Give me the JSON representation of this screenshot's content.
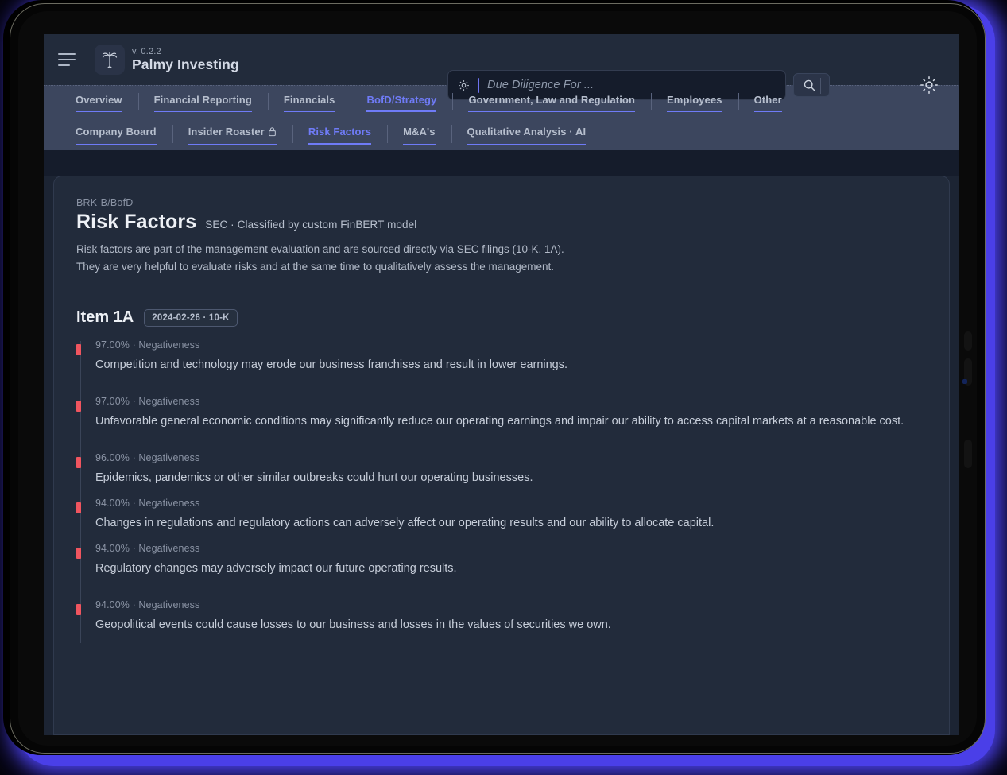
{
  "header": {
    "menu_icon": "hamburger-icon",
    "logo_icon": "palm-tree-icon",
    "version": "v. 0.2.2",
    "app_title": "Palmy Investing",
    "theme_icon": "sun-icon",
    "search": {
      "settings_icon": "gear-icon",
      "placeholder": "Due Diligence For ...",
      "value": "",
      "submit_icon": "search-icon"
    }
  },
  "nav_primary": {
    "items": [
      {
        "label": "Overview",
        "active": false
      },
      {
        "label": "Financial Reporting",
        "active": false
      },
      {
        "label": "Financials",
        "active": false
      },
      {
        "label": "BofD/Strategy",
        "active": true
      },
      {
        "label": "Government, Law and Regulation",
        "active": false
      },
      {
        "label": "Employees",
        "active": false
      },
      {
        "label": "Other",
        "active": false
      }
    ]
  },
  "nav_secondary": {
    "items": [
      {
        "label": "Company Board",
        "active": false,
        "icon": ""
      },
      {
        "label": "Insider Roaster",
        "active": false,
        "icon": "lock-icon"
      },
      {
        "label": "Risk Factors",
        "active": true,
        "icon": ""
      },
      {
        "label": "M&A's",
        "active": false,
        "icon": ""
      },
      {
        "label": "Qualitative Analysis  ·  AI",
        "active": false,
        "icon": ""
      }
    ]
  },
  "content": {
    "breadcrumb": "BRK-B/BofD",
    "title": "Risk Factors",
    "subtitle": "SEC · Classified by custom FinBERT model",
    "intro_line_1": "Risk factors are part of the management evaluation and are sourced directly via SEC filings (10-K, 1A).",
    "intro_line_2": "They are very helpful to evaluate risks and at the same time to qualitatively assess the management.",
    "section_title": "Item 1A",
    "section_badge": "2024-02-26 · 10-K",
    "marker_color": "#f0555f",
    "risk_items": [
      {
        "score": "97.00%",
        "label": "Negativeness",
        "meta": "97.00% · Negativeness",
        "text": "Competition and technology may erode our business franchises and result in lower earnings."
      },
      {
        "score": "97.00%",
        "label": "Negativeness",
        "meta": "97.00% · Negativeness",
        "text": "Unfavorable general economic conditions may significantly reduce our operating earnings and impair our ability to access capital markets at a reasonable cost."
      },
      {
        "score": "96.00%",
        "label": "Negativeness",
        "meta": "96.00% · Negativeness",
        "text": "Epidemics, pandemics or other similar outbreaks could hurt our operating businesses."
      },
      {
        "score": "94.00%",
        "label": "Negativeness",
        "meta": "94.00% · Negativeness",
        "text": "Changes in regulations and regulatory actions can adversely affect our operating results and our ability to allocate capital."
      },
      {
        "score": "94.00%",
        "label": "Negativeness",
        "meta": "94.00% · Negativeness",
        "text": "Regulatory changes may adversely impact our future operating results."
      },
      {
        "score": "94.00%",
        "label": "Negativeness",
        "meta": "94.00% · Negativeness",
        "text": "Geopolitical events could cause losses to our business and losses in the values of securities we own."
      }
    ]
  },
  "theme": {
    "accent": "#6f7bf7",
    "glow": "#4a3fe8",
    "screen_bg": "#1c2433",
    "panel_bg": "#222b3b",
    "nav_bg": "#3c465e"
  }
}
